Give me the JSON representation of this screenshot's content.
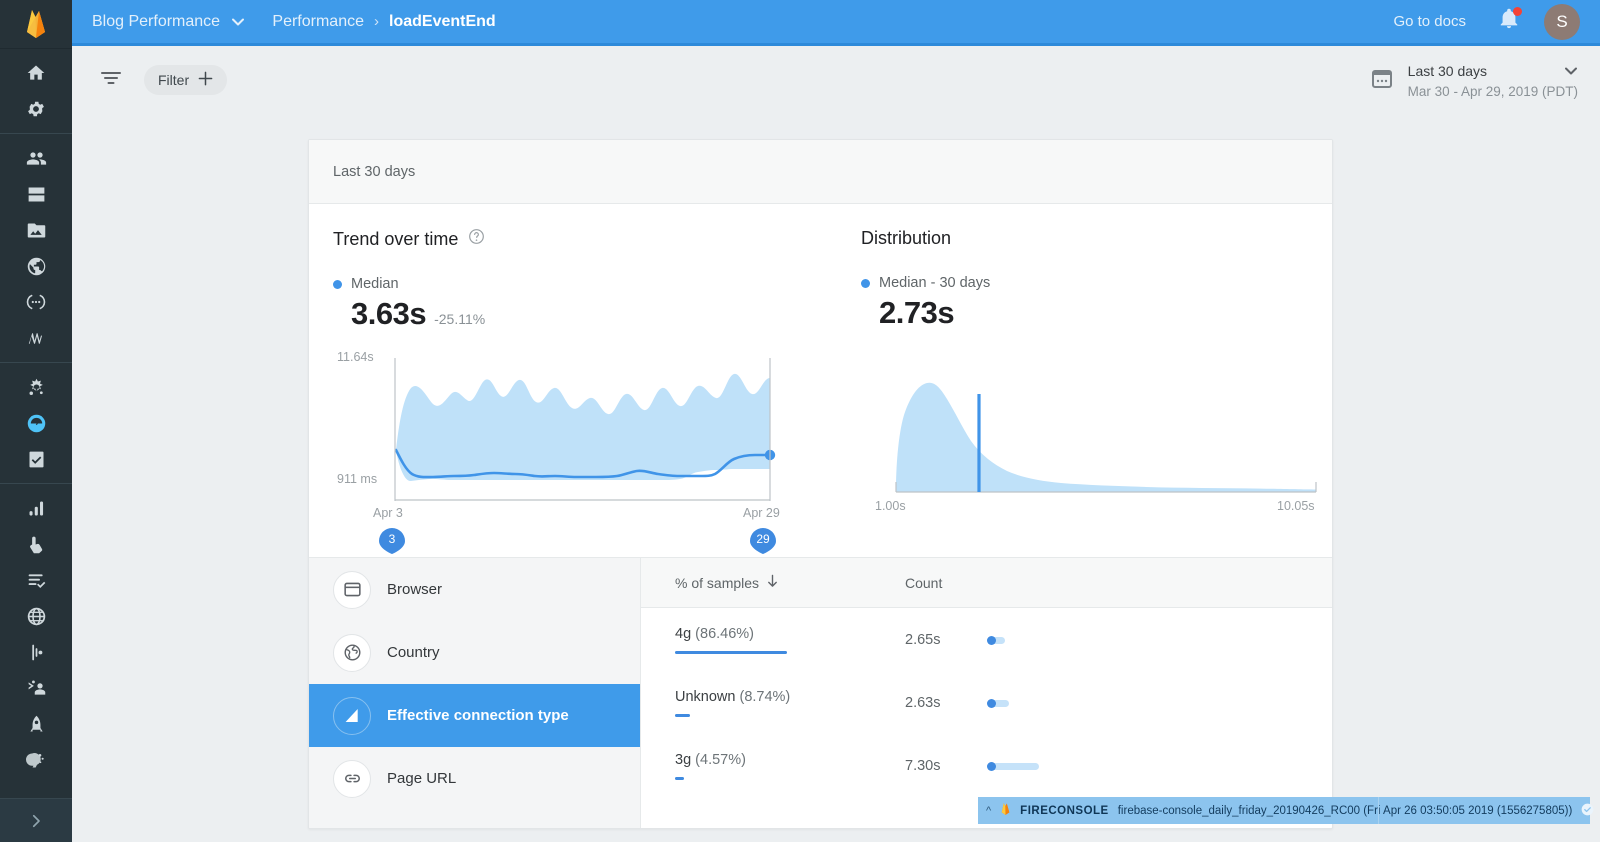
{
  "rail": {
    "logo_icon": "firebase-flame-logo",
    "sections": [
      {
        "items": [
          {
            "icon": "home-icon",
            "name": "home"
          },
          {
            "icon": "gear-icon",
            "name": "settings"
          }
        ]
      },
      {
        "items": [
          {
            "icon": "people-icon",
            "name": "authentication"
          },
          {
            "icon": "database-icon",
            "name": "database"
          },
          {
            "icon": "image-folder-icon",
            "name": "storage"
          },
          {
            "icon": "globe-icon",
            "name": "hosting"
          },
          {
            "icon": "functions-icon",
            "name": "functions"
          },
          {
            "icon": "ml-kit-icon",
            "name": "ml-kit"
          }
        ]
      },
      {
        "items": [
          {
            "icon": "crashlytics-icon",
            "name": "crashlytics"
          },
          {
            "icon": "performance-icon",
            "name": "performance",
            "active": true
          },
          {
            "icon": "test-lab-icon",
            "name": "test-lab"
          }
        ]
      },
      {
        "items": [
          {
            "icon": "analytics-bars-icon",
            "name": "analytics"
          },
          {
            "icon": "tap-finger-icon",
            "name": "events"
          },
          {
            "icon": "checklist-icon",
            "name": "conversions"
          },
          {
            "icon": "globe-grid-icon",
            "name": "audiences"
          },
          {
            "icon": "funnel-bars-icon",
            "name": "funnels"
          },
          {
            "icon": "user-retention-icon",
            "name": "retention"
          },
          {
            "icon": "rocket-icon",
            "name": "predictions"
          },
          {
            "icon": "dust-icon",
            "name": "streamview"
          }
        ]
      }
    ],
    "expand_icon": "chevron-right-icon"
  },
  "topbar": {
    "project_name": "Blog Performance",
    "project_caret_icon": "chevron-down-icon",
    "breadcrumb_parent": "Performance",
    "breadcrumb_sep": "›",
    "breadcrumb_current": "loadEventEnd",
    "docs_link": "Go to docs",
    "bell_icon": "notification-bell-icon",
    "avatar_initial": "S",
    "bg_color": "#3f9bea"
  },
  "filterbar": {
    "filter_toggle_icon": "filter-lines-icon",
    "filter_chip_label": "Filter",
    "filter_chip_plus_icon": "plus-icon",
    "calendar_icon": "calendar-icon",
    "range_label": "Last 30 days",
    "range_caret_icon": "chevron-down-icon",
    "range_sub": "Mar 30 - Apr 29, 2019 (PDT)"
  },
  "card": {
    "header_title": "Last 30 days"
  },
  "trend": {
    "title": "Trend over time",
    "help_icon": "help-circle-icon",
    "legend_label": "Median",
    "value": "3.63s",
    "delta": "-25.11%",
    "y_top": "11.64s",
    "y_bottom": "911 ms",
    "x_start": "Apr 3",
    "x_end": "Apr 29",
    "pin_start": "3",
    "pin_end": "29"
  },
  "distribution": {
    "title": "Distribution",
    "legend_label": "Median - 30 days",
    "value": "2.73s",
    "x_start": "1.00s",
    "x_end": "10.05s"
  },
  "chart_data": [
    {
      "type": "area",
      "title": "Trend over time",
      "ylabel": "",
      "xlabel": "",
      "ylim": [
        0.911,
        11.64
      ],
      "ytick_labels": [
        "11.64s",
        "911 ms"
      ],
      "xtick_labels": [
        "Apr 3",
        "Apr 29"
      ],
      "grid": false,
      "legend": [
        "Median"
      ],
      "x": [
        "Apr 3",
        "Apr 4",
        "Apr 5",
        "Apr 6",
        "Apr 7",
        "Apr 8",
        "Apr 9",
        "Apr 10",
        "Apr 11",
        "Apr 12",
        "Apr 13",
        "Apr 14",
        "Apr 15",
        "Apr 16",
        "Apr 17",
        "Apr 18",
        "Apr 19",
        "Apr 20",
        "Apr 21",
        "Apr 22",
        "Apr 23",
        "Apr 24",
        "Apr 25",
        "Apr 26",
        "Apr 27",
        "Apr 28",
        "Apr 29"
      ],
      "series": [
        {
          "name": "Median",
          "values": [
            4.85,
            3.35,
            3.25,
            3.28,
            3.28,
            3.25,
            3.3,
            3.4,
            3.35,
            3.3,
            3.35,
            3.3,
            3.22,
            3.2,
            3.2,
            3.22,
            3.25,
            3.45,
            3.3,
            3.22,
            3.2,
            3.22,
            3.25,
            3.9,
            4.05,
            4.1,
            4.12
          ]
        },
        {
          "name": "Upper band",
          "values": [
            4.85,
            9.3,
            10.0,
            9.6,
            8.9,
            9.25,
            10.3,
            9.7,
            10.1,
            9.65,
            9.2,
            9.9,
            9.55,
            9.15,
            9.3,
            9.0,
            8.5,
            8.9,
            8.4,
            9.45,
            9.0,
            9.35,
            9.0,
            9.3,
            10.55,
            9.8,
            11.2
          ]
        },
        {
          "name": "Lower band",
          "values": [
            4.85,
            1.55,
            1.62,
            1.65,
            1.65,
            1.66,
            1.66,
            1.66,
            1.66,
            1.66,
            1.66,
            1.66,
            1.66,
            1.65,
            1.65,
            1.65,
            1.66,
            1.66,
            1.66,
            1.66,
            1.66,
            1.66,
            1.66,
            2.1,
            2.15,
            2.15,
            2.15
          ]
        }
      ]
    },
    {
      "type": "area",
      "title": "Distribution",
      "xlabel": "",
      "ylabel": "",
      "xtick_labels": [
        "1.00s",
        "10.05s"
      ],
      "xlim": [
        1.0,
        10.05
      ],
      "grid": false,
      "legend": [
        "Median - 30 days"
      ],
      "median_marker": 2.73,
      "x": [
        1.0,
        1.2,
        1.45,
        1.7,
        1.95,
        2.2,
        2.45,
        2.73,
        3.0,
        3.4,
        3.8,
        4.2,
        4.7,
        5.2,
        5.8,
        6.4,
        7.0,
        7.6,
        8.2,
        8.8,
        9.4,
        10.05
      ],
      "values": [
        0.02,
        0.62,
        0.88,
        0.97,
        1.0,
        0.97,
        0.9,
        0.8,
        0.7,
        0.56,
        0.45,
        0.37,
        0.29,
        0.23,
        0.17,
        0.13,
        0.1,
        0.08,
        0.06,
        0.04,
        0.03,
        0.01
      ]
    }
  ],
  "dimensions": {
    "items": [
      {
        "label": "Browser",
        "icon": "browser-window-icon",
        "selected": false
      },
      {
        "label": "Country",
        "icon": "globe-icon",
        "selected": false
      },
      {
        "label": "Effective connection type",
        "icon": "signal-triangle-icon",
        "selected": true
      },
      {
        "label": "Page URL",
        "icon": "link-icon",
        "selected": false
      }
    ]
  },
  "table": {
    "columns": [
      {
        "label": "% of samples",
        "sort_icon": "arrow-down-icon"
      },
      {
        "label": "Count"
      }
    ],
    "rows": [
      {
        "name": "4g",
        "pct_text": "(86.46%)",
        "pct": 86.46,
        "count": "2.65s",
        "spark_dot": 0,
        "spark_width": 14
      },
      {
        "name": "Unknown",
        "pct_text": "(8.74%)",
        "pct": 8.74,
        "count": "2.63s",
        "spark_dot": 0,
        "spark_width": 18
      },
      {
        "name": "3g",
        "pct_text": "(4.57%)",
        "pct": 4.57,
        "count": "7.30s",
        "spark_dot": 0,
        "spark_width": 48
      }
    ]
  },
  "statusbar": {
    "caret_icon": "chevron-up-icon",
    "flame_icon": "firebase-flame-icon",
    "brand": "FIRECONSOLE",
    "text": "firebase-console_daily_friday_20190426_RC00 (Fri Apr 26 03:50:05 2019 (1556275805))",
    "check_icon": "check-circle-icon",
    "close_icon": "close-icon"
  }
}
